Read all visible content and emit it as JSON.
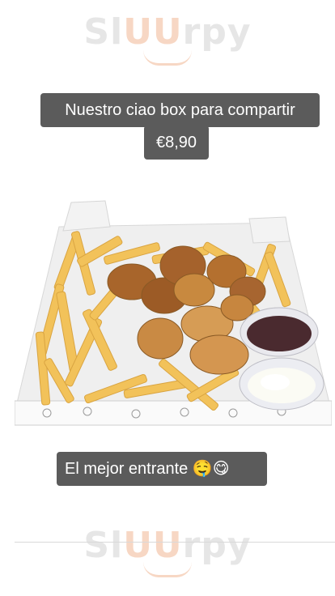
{
  "watermark": {
    "brand_prefix": "Sl",
    "brand_accent": "UU",
    "brand_suffix": "rpy"
  },
  "caption": {
    "title": "Nuestro ciao box para compartir",
    "price": "€8,90",
    "subtitle": "El mejor entrante 🤤😋"
  },
  "colors": {
    "caption_bg": "#5b5b5b",
    "caption_text": "#ffffff",
    "watermark": "#e6e6e6"
  },
  "photo": {
    "subject": "food-box-icon"
  }
}
